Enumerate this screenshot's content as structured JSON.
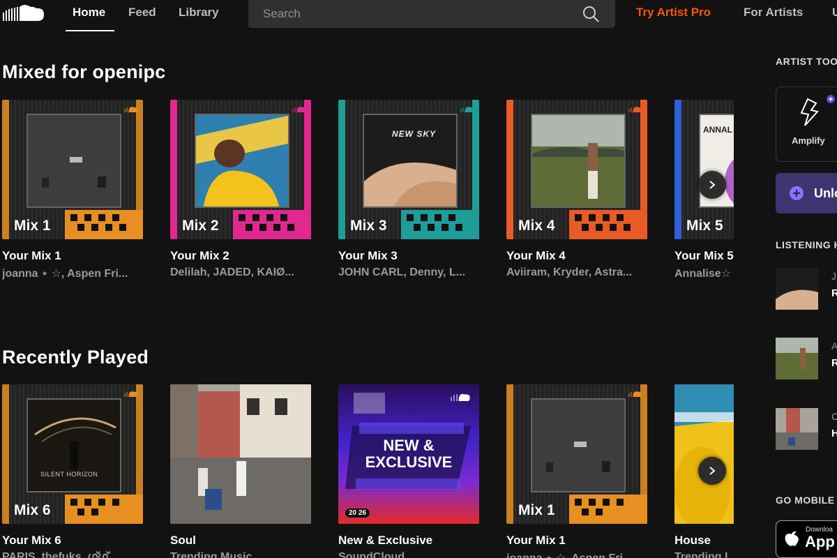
{
  "header": {
    "nav": [
      {
        "label": "Home"
      },
      {
        "label": "Feed"
      },
      {
        "label": "Library"
      }
    ],
    "search_placeholder": "Search",
    "try_pro": "Try Artist Pro",
    "for_artists": "For Artists",
    "upload_partial": "U"
  },
  "mixed": {
    "title": "Mixed for openipc",
    "items": [
      {
        "tile": "Mix 1",
        "title": "Your Mix 1",
        "subtitle": "joanna ⋆ ☆, Aspen Fri...",
        "color": "#e88f21"
      },
      {
        "tile": "Mix 2",
        "title": "Your Mix 2",
        "subtitle": "Delilah, JADED, KAIØ...",
        "color": "#e1288f"
      },
      {
        "tile": "Mix 3",
        "title": "Your Mix 3",
        "subtitle": "JOHN CARL, Denny, L...",
        "color": "#1f9d99"
      },
      {
        "tile": "Mix 4",
        "title": "Your Mix 4",
        "subtitle": "Aviiram, Kryder, Astra...",
        "color": "#ea5a25"
      },
      {
        "tile": "Mix 5",
        "title": "Your Mix 5",
        "subtitle": "Annalise☆",
        "color": "#2d5fd6"
      }
    ],
    "mix3_cover_text": [
      "NEW SKY"
    ],
    "mix5_cover_text": "ANNAL"
  },
  "recent": {
    "title": "Recently Played",
    "items": [
      {
        "tile": "Mix 6",
        "title": "Your Mix 6",
        "subtitle": "PARIS, thefuks, ഗ്ഗ്ഗ്",
        "cover_text": "SILENT HORIZON",
        "color": "#e88f21"
      },
      {
        "tile": "",
        "title": "Soul",
        "subtitle": "Trending Music"
      },
      {
        "tile": "",
        "title": "New & Exclusive",
        "subtitle": "SoundCloud",
        "cover_line1": "NEW &",
        "cover_line2": "EXCLUSIVE",
        "cover_year": "20 26"
      },
      {
        "tile": "Mix 1",
        "title": "Your Mix 1",
        "subtitle": "joanna ⋆ ☆, Aspen Fri...",
        "color": "#e88f21"
      },
      {
        "tile": "",
        "title": "House",
        "subtitle": "Trending I..."
      }
    ]
  },
  "sidebar": {
    "artist_tools": "ARTIST TOO",
    "amplify": "Amplify",
    "unlock": "Unlo",
    "listening_history": "LISTENING H",
    "history_initials": [
      "J",
      "A",
      "C"
    ],
    "history_second": [
      "R",
      "R",
      "H"
    ],
    "go_mobile": "GO MOBILE",
    "app_store_small": "Downloa",
    "app_store_big": "App"
  },
  "colors": {
    "accent": "#ff5500",
    "background": "#121212",
    "search_bg": "#303030",
    "unlock_bg": "#3d3470"
  }
}
